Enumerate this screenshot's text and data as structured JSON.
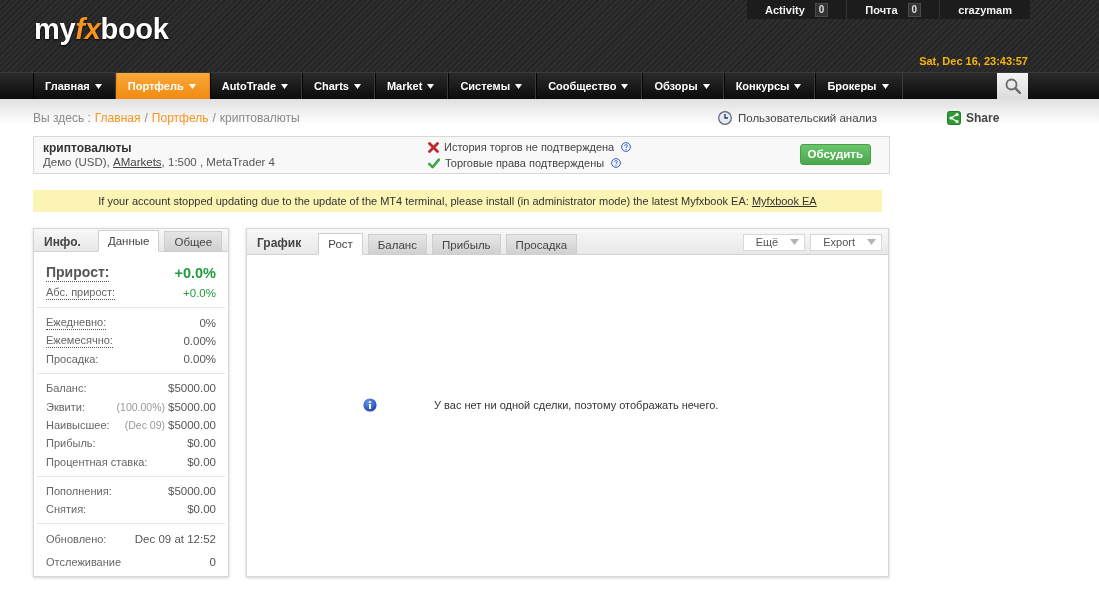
{
  "header": {
    "logo": {
      "start": "my",
      "accent": "fx",
      "end": "book"
    },
    "user_bar": [
      {
        "label": "Activity",
        "count": "0"
      },
      {
        "label": "Почта",
        "count": "0"
      },
      {
        "label": "crazymam"
      }
    ],
    "datetime": "Sat, Dec 16, 23:43:57"
  },
  "nav": {
    "items": [
      {
        "label": "Главная",
        "selected": false
      },
      {
        "label": "Портфель",
        "selected": true
      },
      {
        "label": "AutoTrade",
        "selected": false
      },
      {
        "label": "Charts",
        "selected": false
      },
      {
        "label": "Market",
        "selected": false
      },
      {
        "label": "Системы",
        "selected": false
      },
      {
        "label": "Сообщество",
        "selected": false
      },
      {
        "label": "Обзоры",
        "selected": false
      },
      {
        "label": "Конкурсы",
        "selected": false
      },
      {
        "label": "Брокеры",
        "selected": false
      }
    ]
  },
  "breadcrumb": [
    {
      "text": "Вы здесь :",
      "kind": "label"
    },
    {
      "text": "Главная",
      "kind": "link"
    },
    {
      "text": "/",
      "kind": "separator"
    },
    {
      "text": "Портфель",
      "kind": "link"
    },
    {
      "text": "/",
      "kind": "separator"
    },
    {
      "text": "криптовалюты",
      "kind": "current"
    }
  ],
  "custom_analysis": "Пользовательский анализ",
  "share": "Share",
  "account": {
    "name": "криптовалюты",
    "details": {
      "before": "Демо (USD),",
      "link": "AMarkets",
      "after": ", 1:500 , MetaTrader 4"
    },
    "verification": [
      {
        "text": "История торгов не подтверждена",
        "verified": false
      },
      {
        "text": "Торговые права подтверждены",
        "verified": true
      }
    ],
    "discuss_button": "Обсудить"
  },
  "notice": {
    "text": "If your account stopped updating due to the update of the MT4 terminal, please install (in administrator mode) the latest Myfxbook EA:",
    "link": "Myfxbook EA"
  },
  "info_panel": {
    "title": "Инфо.",
    "tabs": [
      {
        "label": "Данные",
        "selected": true
      },
      {
        "label": "Общее",
        "selected": false
      }
    ],
    "sections": [
      {
        "rows": [
          {
            "label": "Прирост:",
            "value": "+0.0%",
            "kind": "headline",
            "tooltip": true
          },
          {
            "label": "Абс. прирост:",
            "value": "+0.0%",
            "kind": "gain",
            "tooltip": true
          }
        ]
      },
      {
        "rows": [
          {
            "label": "Ежедневно:",
            "value": "0%",
            "kind": "plain",
            "tooltip": true
          },
          {
            "label": "Ежемесячно:",
            "value": "0.00%",
            "kind": "plain",
            "tooltip": true
          },
          {
            "label": "Просадка:",
            "value": "0.00%",
            "kind": "plain",
            "tooltip": false
          }
        ]
      },
      {
        "rows": [
          {
            "label": "Баланс:",
            "value": "$5000.00",
            "kind": "plain",
            "tooltip": false
          },
          {
            "label": "Эквити:",
            "note": "(100.00%)",
            "value": "$5000.00",
            "kind": "plain",
            "tooltip": false
          },
          {
            "label": "Наивысшее:",
            "note": "(Dec 09)",
            "value": "$5000.00",
            "kind": "plain",
            "tooltip": false
          },
          {
            "label": "Прибыль:",
            "value": "$0.00",
            "kind": "plain",
            "tooltip": false
          },
          {
            "label": "Процентная ставка:",
            "value": "$0.00",
            "kind": "plain",
            "tooltip": false
          }
        ]
      },
      {
        "rows": [
          {
            "label": "Пополнения:",
            "value": "$5000.00",
            "kind": "plain",
            "tooltip": false
          },
          {
            "label": "Снятия:",
            "value": "$0.00",
            "kind": "plain",
            "tooltip": false
          }
        ]
      },
      {
        "rows": [
          {
            "label": "Обновлено:",
            "value": "Dec 09 at 12:52",
            "kind": "plain",
            "tooltip": false
          },
          {
            "label": "Отслеживание",
            "value": "0",
            "kind": "plain",
            "tooltip": false
          }
        ]
      }
    ]
  },
  "chart_panel": {
    "title": "График",
    "tabs": [
      {
        "label": "Рост",
        "selected": true
      },
      {
        "label": "Баланс",
        "selected": false
      },
      {
        "label": "Прибыль",
        "selected": false
      },
      {
        "label": "Просадка",
        "selected": false
      }
    ],
    "menus": [
      "Ещё",
      "Export"
    ],
    "message": "У вас нет ни одной сделки, поэтому отображать нечего."
  }
}
